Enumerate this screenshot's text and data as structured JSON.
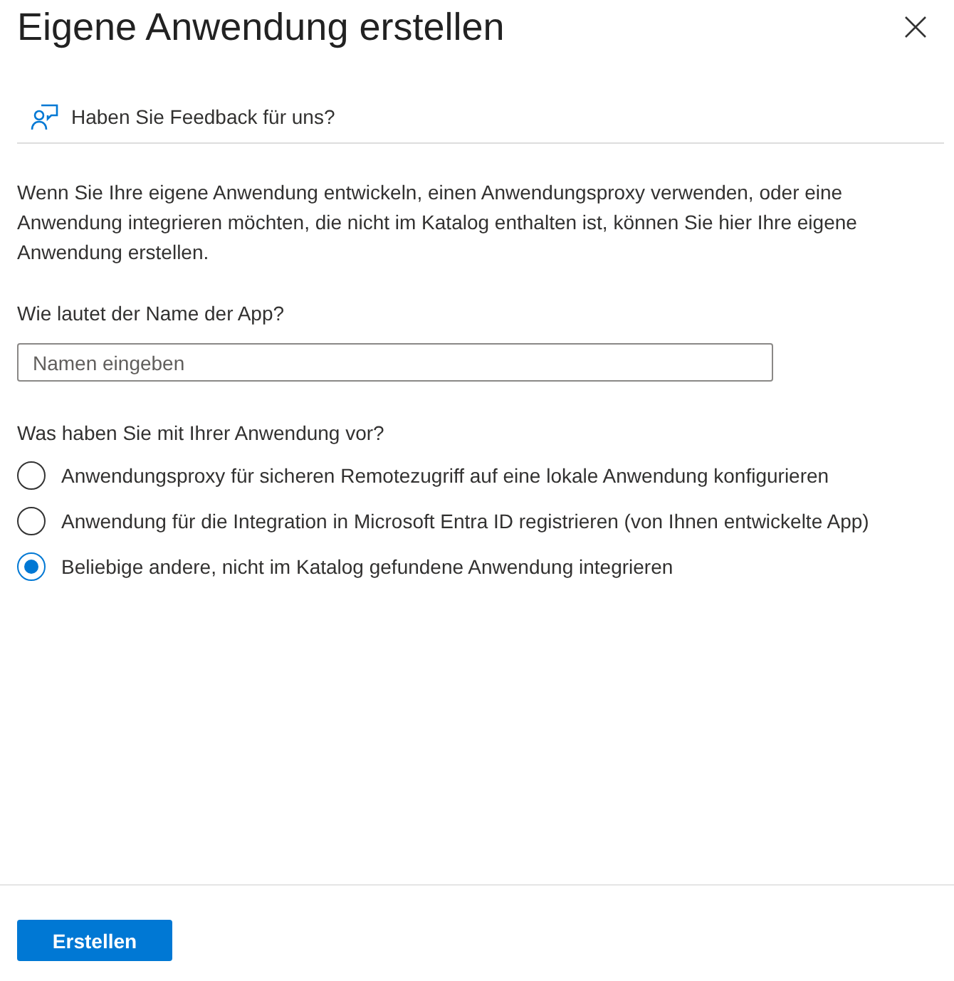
{
  "title": "Eigene Anwendung erstellen",
  "feedback": {
    "label": "Haben Sie Feedback für uns?"
  },
  "intro": "Wenn Sie Ihre eigene Anwendung entwickeln, einen Anwendungsproxy verwenden, oder eine Anwendung integrieren möchten, die nicht im Katalog enthalten ist, können Sie hier Ihre eigene Anwendung erstellen.",
  "name_field": {
    "label": "Wie lautet der Name der App?",
    "placeholder": "Namen eingeben"
  },
  "purpose": {
    "label": "Was haben Sie mit Ihrer Anwendung vor?",
    "options": [
      {
        "label": "Anwendungsproxy für sicheren Remotezugriff auf eine lokale Anwendung konfigurieren",
        "selected": false
      },
      {
        "label": "Anwendung für die Integration in Microsoft Entra ID registrieren (von Ihnen entwickelte App)",
        "selected": false
      },
      {
        "label": "Beliebige andere, nicht im Katalog gefundene Anwendung integrieren",
        "selected": true
      }
    ]
  },
  "create_button": "Erstellen"
}
